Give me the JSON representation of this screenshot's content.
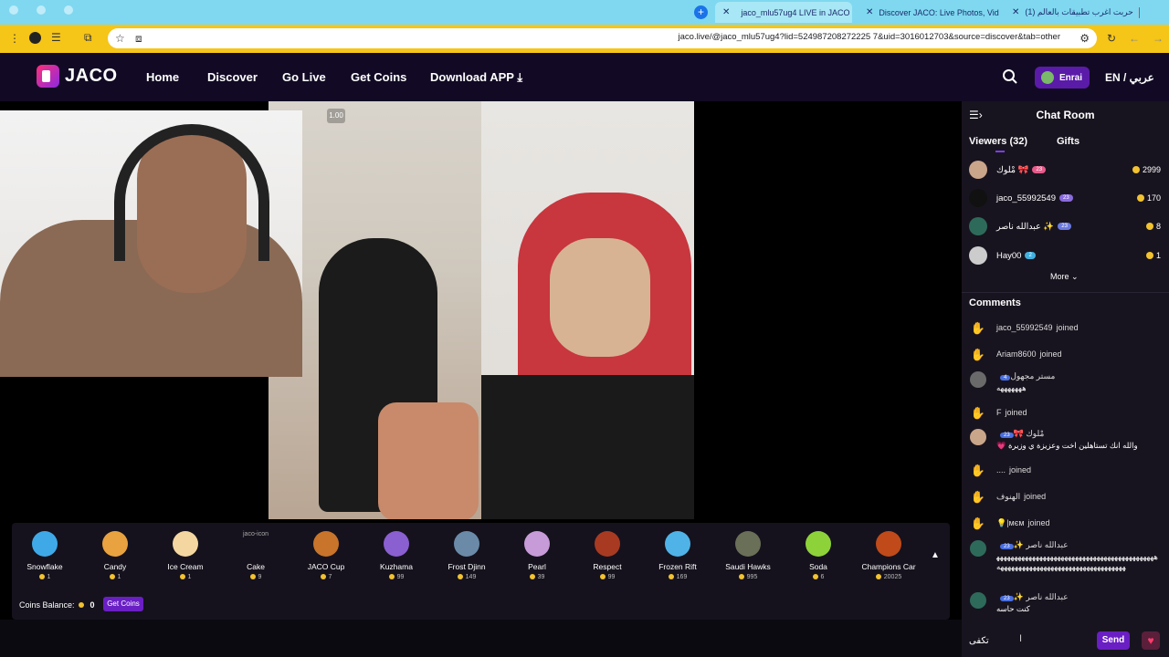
{
  "browser": {
    "tabs": [
      {
        "label": "jaco_mlu57ug4 LIVE in JACO",
        "active": true
      },
      {
        "label": "Discover JACO: Live Photos, Vid",
        "active": false
      },
      {
        "label": "(1) حربت اغرب تطبيقات بالعالم",
        "active": false
      }
    ],
    "url": "jaco.live/@jaco_mlu57ug4?lid=524987208272225 7&uid=3016012703&source=discover&tab=other"
  },
  "header": {
    "logo": "JACO",
    "nav": [
      "Home",
      "Discover",
      "Go Live",
      "Get Coins",
      "Download APP"
    ],
    "user": "Enrai",
    "lang": "EN / عربي"
  },
  "video": {
    "speed": "1.00"
  },
  "gifts": [
    {
      "name": "Snowflake",
      "price": "1",
      "color": "#3fa9e8"
    },
    {
      "name": "Candy",
      "price": "1",
      "color": "#e8a23f"
    },
    {
      "name": "Ice Cream",
      "price": "1",
      "color": "#f4d7a0"
    },
    {
      "name": "Cake",
      "price": "9",
      "color": "#15121d",
      "alt": "jaco-icon"
    },
    {
      "name": "JACO Cup",
      "price": "7",
      "color": "#c8742a"
    },
    {
      "name": "Kuzhama",
      "price": "99",
      "color": "#8a5fd0"
    },
    {
      "name": "Frost Djinn",
      "price": "149",
      "color": "#6a8aa8"
    },
    {
      "name": "Pearl",
      "price": "39",
      "color": "#c79ad8"
    },
    {
      "name": "Respect",
      "price": "99",
      "color": "#a83a22"
    },
    {
      "name": "Frozen Rift",
      "price": "169",
      "color": "#4fb3e8"
    },
    {
      "name": "Saudi Hawks",
      "price": "995",
      "color": "#6a6f58"
    },
    {
      "name": "Soda",
      "price": "6",
      "color": "#8ed23a"
    },
    {
      "name": "Champions Car",
      "price": "20025",
      "color": "#c04a1a"
    }
  ],
  "coins": {
    "label": "Coins Balance:",
    "value": "0",
    "button": "Get Coins"
  },
  "chat": {
    "title": "Chat Room",
    "tabs": {
      "viewers": "Viewers (32)",
      "gifts": "Gifts"
    },
    "viewers": [
      {
        "name": "مْلوك 🎀",
        "badge": "23",
        "badge_color": "#e85a8a",
        "coins": "2999",
        "avatar": "#c9a58a"
      },
      {
        "name": "jaco_55992549",
        "badge": "23",
        "badge_color": "#8a6ae0",
        "coins": "170",
        "avatar": "#111"
      },
      {
        "name": "عبدالله ناصر ✨",
        "badge": "23",
        "badge_color": "#6a7ae0",
        "coins": "8",
        "avatar": "#2e6a5a"
      },
      {
        "name": "Hay00",
        "badge": "2",
        "badge_color": "#3fb0e0",
        "coins": "1",
        "avatar": "#ccc"
      }
    ],
    "more": "More",
    "comments_title": "Comments",
    "comments": [
      {
        "name": "jaco_55992549",
        "text": "joined",
        "type": "join"
      },
      {
        "name": "Ariam8600",
        "text": "joined",
        "type": "join"
      },
      {
        "name": "مستر مجهول",
        "text": "هههههههه",
        "type": "msg",
        "avatar": "#6a6a6a",
        "badge": "4"
      },
      {
        "name": "F",
        "text": "joined",
        "type": "join"
      },
      {
        "name": "مْلوك 🎀",
        "text": "والله انك تستاهلين اخت وعزيزة ي وزيرة 💗",
        "type": "msg",
        "avatar": "#c9a58a",
        "badge": "23"
      },
      {
        "name": "....",
        "text": "joined",
        "type": "join"
      },
      {
        "name": "الهنوف",
        "text": "joined",
        "type": "join"
      },
      {
        "name": "💡|мєм",
        "text": "joined",
        "type": "join"
      },
      {
        "name": "عبدالله ناصر ✨",
        "text": "ههههههههههههههههههههههههههههههههههههههههههههههههههههههههههههههههههههههههههههههههه",
        "type": "msg",
        "avatar": "#2e6a5a",
        "badge": "23"
      },
      {
        "name": "عبدالله ناصر ✨",
        "text": "كنت حاسه",
        "type": "msg",
        "avatar": "#2e6a5a",
        "badge": "23"
      }
    ],
    "input_value": "تكفى",
    "send": "Send"
  }
}
